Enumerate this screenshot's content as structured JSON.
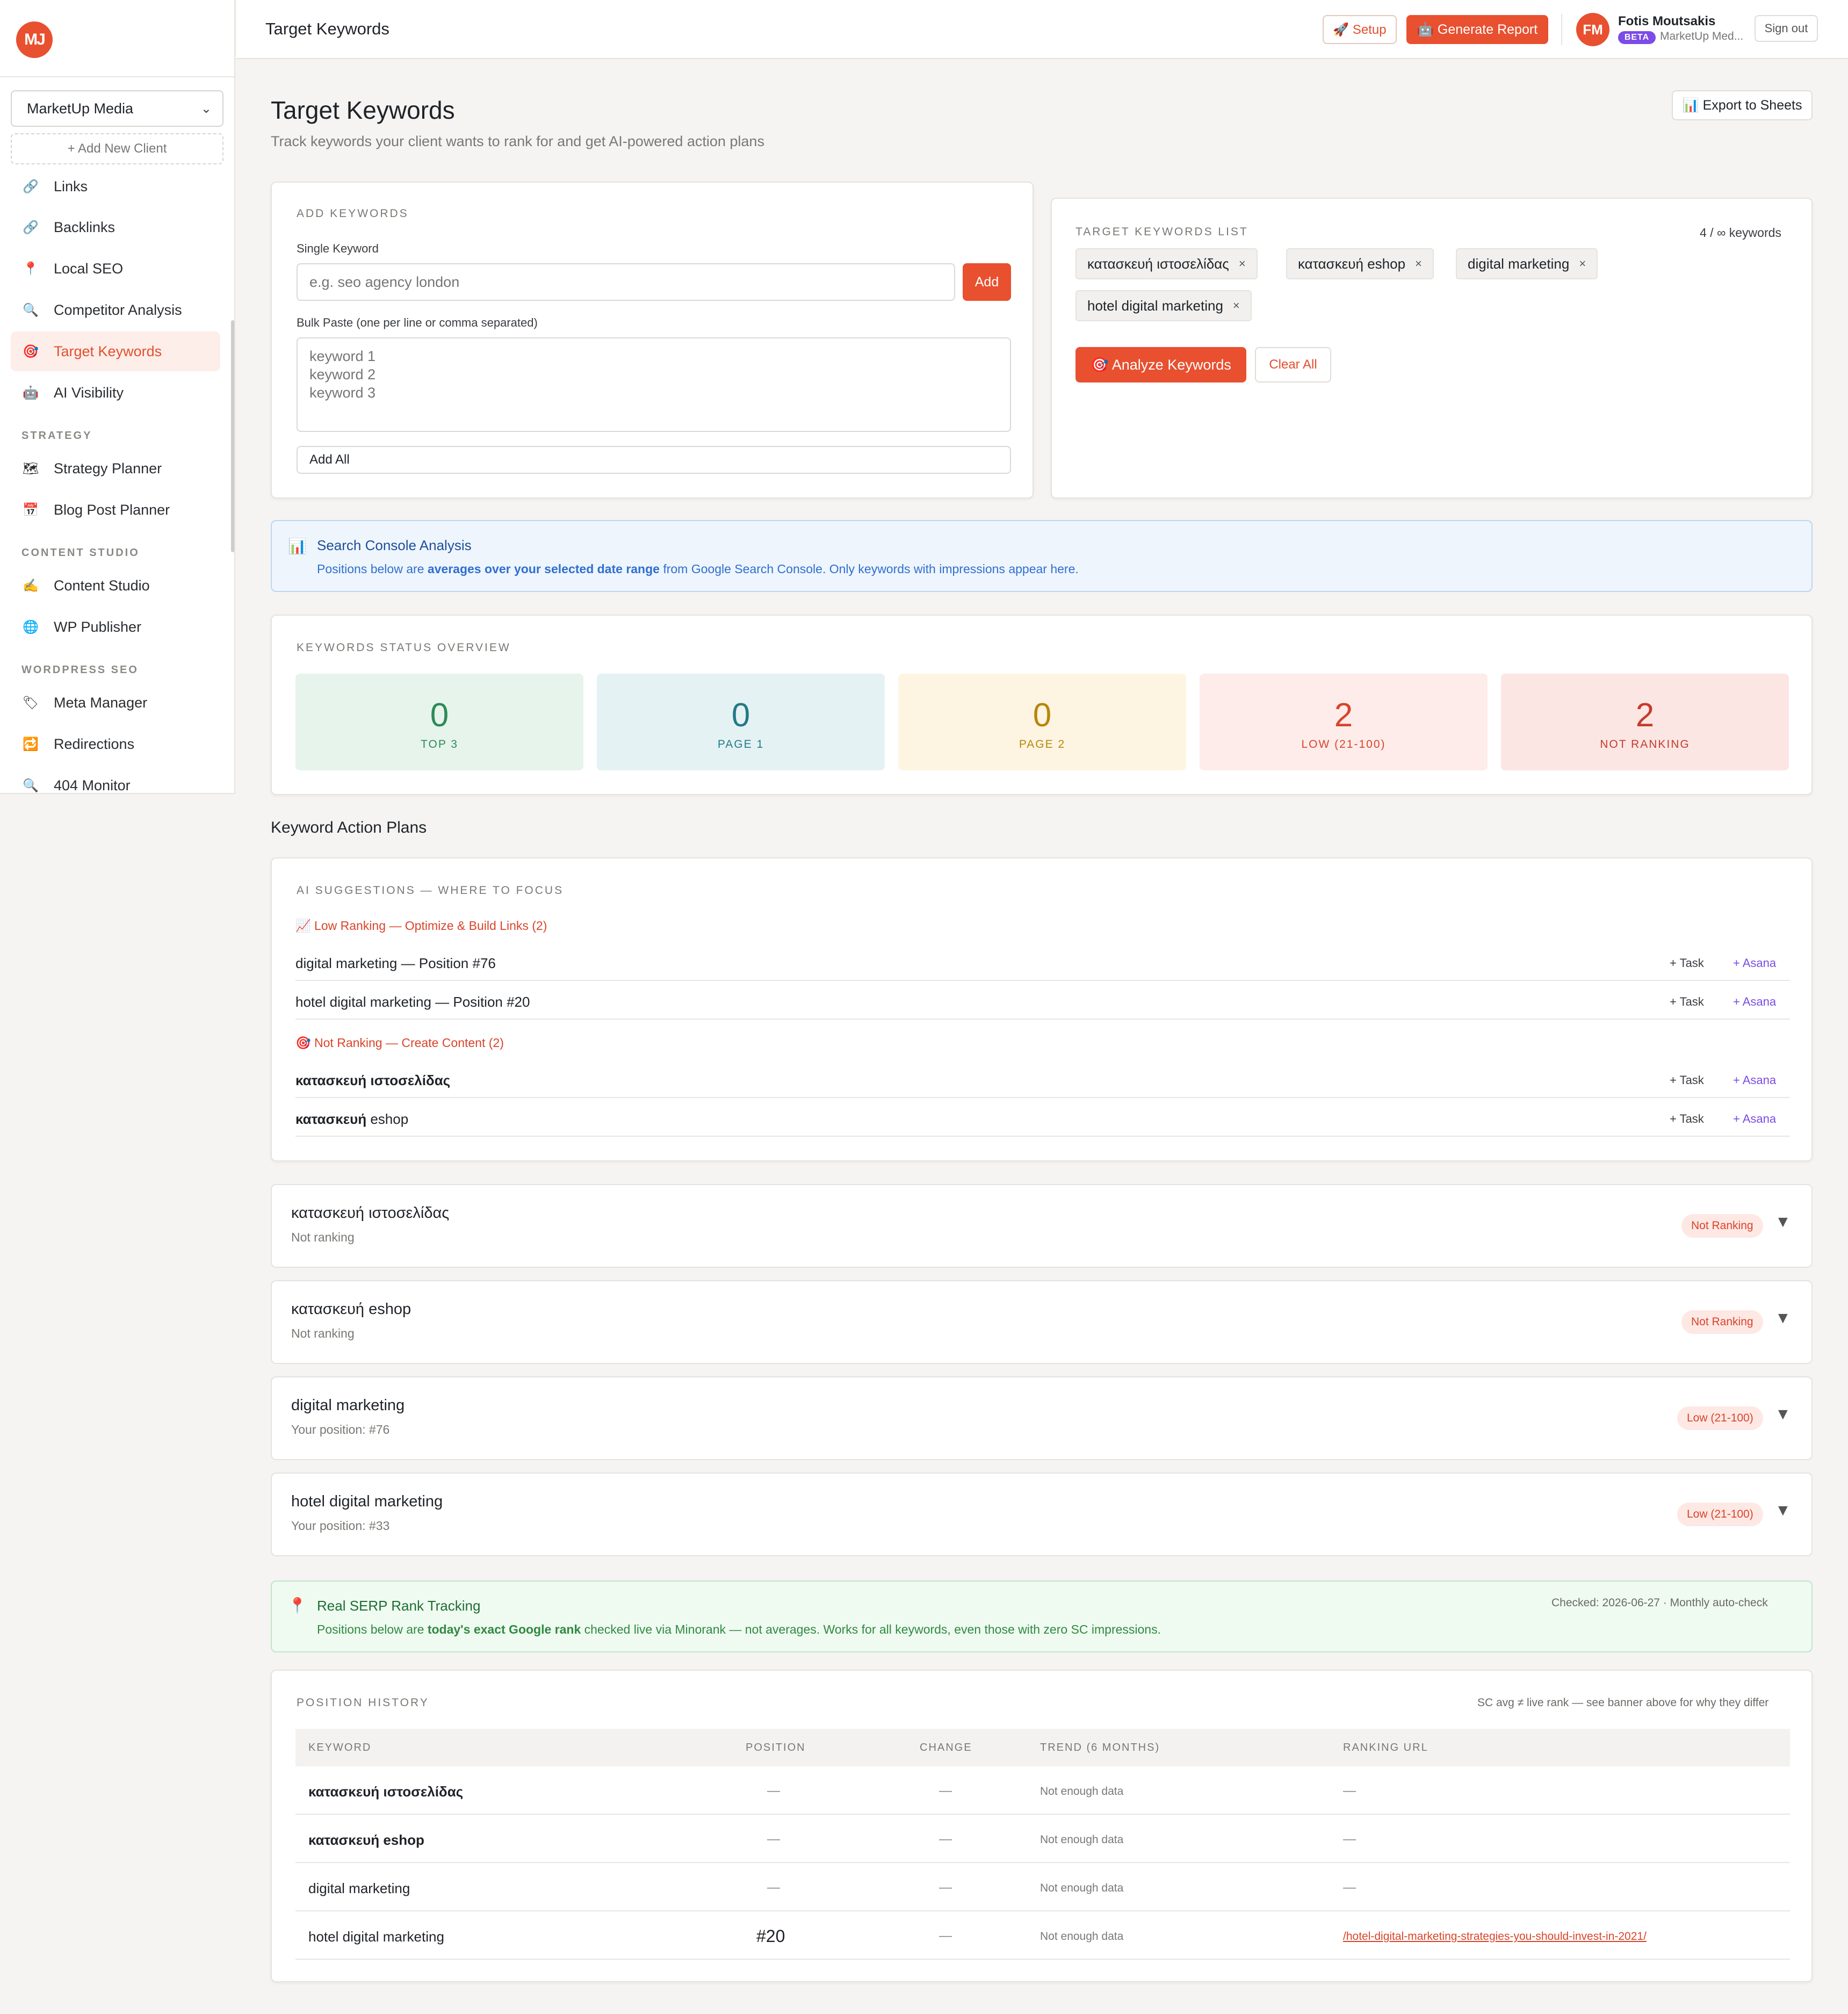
{
  "logo": {
    "text": "MJ"
  },
  "sidebar": {
    "client": "MarketUp Media",
    "add_client": "+ Add New Client",
    "items": [
      {
        "label": "Links",
        "icon": "link-icon",
        "glyph": "🔗"
      },
      {
        "label": "Backlinks",
        "icon": "link-icon",
        "glyph": "🔗"
      },
      {
        "label": "Local SEO",
        "icon": "pin-icon",
        "glyph": "📍"
      },
      {
        "label": "Competitor Analysis",
        "icon": "magnifier-icon",
        "glyph": "🔍"
      },
      {
        "label": "Target Keywords",
        "icon": "target-icon",
        "glyph": "🎯"
      },
      {
        "label": "AI Visibility",
        "icon": "robot-icon",
        "glyph": "🤖"
      },
      {
        "label": "Strategy Planner",
        "icon": "map-icon",
        "glyph": "🗺"
      },
      {
        "label": "Blog Post Planner",
        "icon": "calendar-icon",
        "glyph": "📅"
      },
      {
        "label": "Content Studio",
        "icon": "pen-icon",
        "glyph": "✍"
      },
      {
        "label": "WP Publisher",
        "icon": "globe-icon",
        "glyph": "🌐"
      },
      {
        "label": "Meta Manager",
        "icon": "tag-icon",
        "glyph": "🏷"
      },
      {
        "label": "Redirections",
        "icon": "redirect-icon",
        "glyph": "🔁"
      },
      {
        "label": "404 Monitor",
        "icon": "magnifier-icon",
        "glyph": "🔍"
      }
    ],
    "sections": {
      "strategy": "STRATEGY",
      "content_studio": "CONTENT STUDIO",
      "wordpress_seo": "WORDPRESS SEO"
    }
  },
  "topbar": {
    "title": "Target Keywords",
    "setup": "🚀 Setup",
    "generate_report": "🤖 Generate Report",
    "avatar": "FM",
    "user_name": "Fotis Moutsakis",
    "beta": "BETA",
    "user_org": "MarketUp Med...",
    "sign_out": "Sign out"
  },
  "page": {
    "title": "Target Keywords",
    "subtitle": "Track keywords your client wants to rank for and get AI-powered action plans",
    "export": "📊 Export to Sheets"
  },
  "add_keywords": {
    "caption": "ADD KEYWORDS",
    "single_label": "Single Keyword",
    "single_placeholder": "e.g. seo agency london",
    "add_button": "Add",
    "bulk_label": "Bulk Paste (one per line or comma separated)",
    "bulk_placeholder": "keyword 1\nkeyword 2\nkeyword 3",
    "add_all": "Add All"
  },
  "keywords_list": {
    "caption": "TARGET KEYWORDS LIST",
    "count": "4 / ∞ keywords",
    "chips": [
      "κατασκευή ιστοσελίδας",
      "κατασκευή eshop",
      "digital marketing",
      "hotel digital marketing"
    ],
    "remove_glyph": "×",
    "analyze": "🎯 Analyze Keywords",
    "clear": "Clear All"
  },
  "sc_banner": {
    "title": "Search Console Analysis",
    "text_before": "Positions below are ",
    "text_bold": "averages over your selected date range",
    "text_after": " from Google Search Console. Only keywords with impressions appear here.",
    "color": "#2f6fd0"
  },
  "status_overview": {
    "caption": "KEYWORDS STATUS OVERVIEW",
    "stats": [
      {
        "value": "0",
        "label": "TOP 3",
        "bg": "#e6f4ec",
        "fg": "#2e8a57"
      },
      {
        "value": "0",
        "label": "PAGE 1",
        "bg": "#e4f2f4",
        "fg": "#237a86"
      },
      {
        "value": "0",
        "label": "PAGE 2",
        "bg": "#fdf5e1",
        "fg": "#b8860b"
      },
      {
        "value": "2",
        "label": "LOW (21-100)",
        "bg": "#fdecea",
        "fg": "#d9442a"
      },
      {
        "value": "2",
        "label": "NOT RANKING",
        "bg": "#fbe6e4",
        "fg": "#c53b2c"
      }
    ]
  },
  "action_plans": {
    "heading": "Keyword Action Plans",
    "caption": "AI SUGGESTIONS — WHERE TO FOCUS",
    "groups": [
      {
        "title": "📈 Low Ranking — Optimize & Build Links (2)",
        "rows": [
          {
            "kw": "digital marketing",
            "pos": " — Position #76",
            "bold": false
          },
          {
            "kw": "hotel digital marketing",
            "pos": " — Position #20",
            "bold": false
          }
        ]
      },
      {
        "title": "🎯 Not Ranking — Create Content (2)",
        "rows": [
          {
            "kw": "κατασκευή ιστοσελίδας",
            "pos": "",
            "bold": true
          },
          {
            "kw": "κατασκευή",
            "pos": " eshop",
            "bold": true
          }
        ]
      }
    ],
    "task": "+ Task",
    "asana": "+ Asana"
  },
  "keyword_cards": [
    {
      "title": "κατασκευή ιστοσελίδας",
      "sub": "Not ranking",
      "badge": "Not Ranking"
    },
    {
      "title": "κατασκευή eshop",
      "sub": "Not ranking",
      "badge": "Not Ranking"
    },
    {
      "title": "digital marketing",
      "sub": "Your position: #76",
      "badge": "Low (21-100)"
    },
    {
      "title": "hotel digital marketing",
      "sub": "Your position: #33",
      "badge": "Low (21-100)"
    }
  ],
  "caret_glyph": "▼",
  "serp_banner": {
    "title": "Real SERP Rank Tracking",
    "text_before": "Positions below are ",
    "text_bold": "today's exact Google rank",
    "text_after": " checked live via Minorank — not averages. Works for all keywords, even those with zero SC impressions.",
    "checked": "Checked: 2026-06-27 · Monthly auto-check",
    "color": "#2e8a3f"
  },
  "position_history": {
    "caption": "POSITION HISTORY",
    "note": "SC avg ≠ live rank — see banner above for why they differ",
    "columns": [
      "KEYWORD",
      "POSITION",
      "CHANGE",
      "TREND (6 MONTHS)",
      "RANKING URL"
    ],
    "rows": [
      {
        "kw": "κατασκευή ιστοσελίδας",
        "pos": "—",
        "change": "—",
        "trend": "Not enough data",
        "url": "—"
      },
      {
        "kw": "κατασκευή eshop",
        "pos": "—",
        "change": "—",
        "trend": "Not enough data",
        "url": "—"
      },
      {
        "kw": "digital marketing",
        "pos": "—",
        "change": "—",
        "trend": "Not enough data",
        "url": "—"
      },
      {
        "kw": "hotel digital marketing",
        "pos": "#20",
        "change": "—",
        "trend": "Not enough data",
        "url": "/hotel-digital-marketing-strategies-you-should-invest-in-2021/"
      }
    ]
  }
}
